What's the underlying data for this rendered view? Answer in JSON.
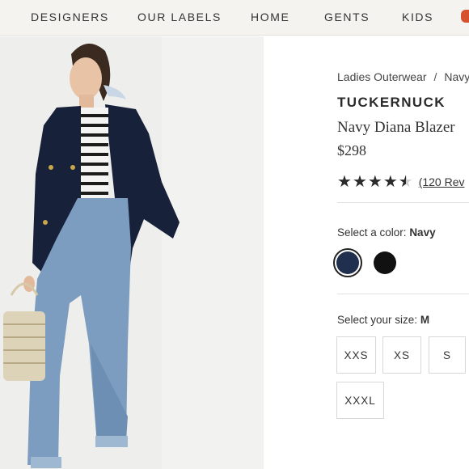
{
  "nav": {
    "items": [
      "DESIGNERS",
      "OUR LABELS",
      "HOME",
      "GENTS",
      "KIDS"
    ]
  },
  "product": {
    "breadcrumb": [
      "Ladies Outerwear",
      "Navy"
    ],
    "brand": "TUCKERNUCK",
    "name": "Navy Diana Blazer",
    "price": "$298",
    "rating": 4.5,
    "reviews_label": "(120 Rev"
  },
  "color_select": {
    "label": "Select a color:",
    "selected": "Navy",
    "swatches": [
      {
        "name": "navy",
        "color": "#1f2f4d"
      },
      {
        "name": "black",
        "color": "#111111"
      }
    ]
  },
  "size_select": {
    "label": "Select your size:",
    "selected": "M",
    "sizes": [
      "XXS",
      "XS",
      "S",
      "XXXL"
    ]
  },
  "colors": {
    "nav_bg": "#f4f3ef",
    "accent": "#d6522f",
    "photo_bg": "#eeeeec"
  }
}
